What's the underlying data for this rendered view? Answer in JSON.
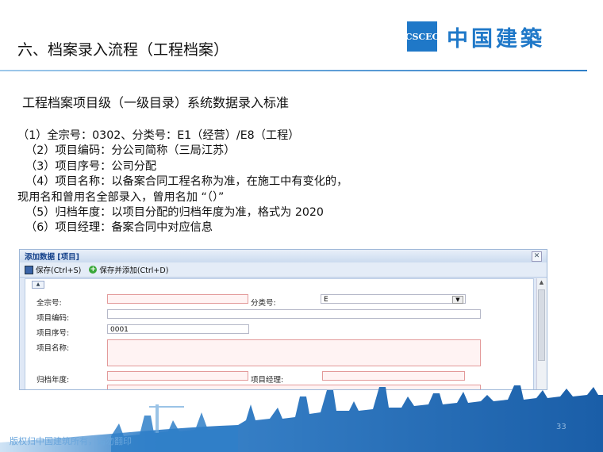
{
  "slide": {
    "title": "六、档案录入流程（工程档案）",
    "subtitle": "工程档案项目级（一级目录）系统数据录入标准",
    "lines": [
      "（1）全宗号：0302、分类号：E1（经营）/E8（工程）",
      "（2）项目编码：分公司简称（三局江苏）",
      "（3）项目序号：公司分配",
      "（4）项目名称：以备案合同工程名称为准，在施工中有变化的，",
      "现用名和曾用名全部录入，曾用名加 “（）”",
      "（5）归档年度：以项目分配的归档年度为准，格式为 2020",
      "（6）项目经理：备案合同中对应信息"
    ],
    "logo_mark": "CSCEC",
    "logo_text": "中国建築",
    "footer": "版权归中国建筑所有，请勿翻印",
    "page_number": "33",
    "colors": {
      "brand": "#1f78c8",
      "required_border": "#e39a9a"
    }
  },
  "dialog": {
    "title": "添加数据 [项目]",
    "close_icon": "close-icon",
    "toolbar": {
      "save_label": "保存(Ctrl+S)",
      "save_add_label": "保存并添加(Ctrl+D)"
    },
    "fields": {
      "quanzong_label": "全宗号:",
      "quanzong_value": "",
      "fenlei_label": "分类号:",
      "fenlei_value": "E",
      "bianma_label": "项目编码:",
      "bianma_value": "",
      "xuhao_label": "项目序号:",
      "xuhao_value": "0001",
      "mingcheng_label": "项目名称:",
      "mingcheng_value": "",
      "niandu_label": "归档年度:",
      "niandu_value": "",
      "jingli_label": "项目经理:",
      "jingli_value": ""
    }
  }
}
